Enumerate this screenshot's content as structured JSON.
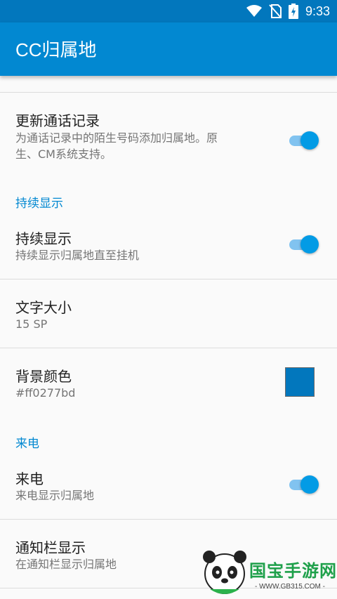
{
  "status_bar": {
    "time": "9:33",
    "icons": [
      "wifi-icon",
      "no-sim-icon",
      "battery-charging-icon"
    ]
  },
  "app_bar": {
    "title": "CC归属地"
  },
  "prefs": {
    "update_call_log": {
      "title": "更新通话记录",
      "summary_line1": "为通话记录中的陌生号码添加归属地。原",
      "summary_line2": "生、CM系统支持。",
      "enabled": true
    },
    "category_persistent": "持续显示",
    "persistent_display": {
      "title": "持续显示",
      "summary": "持续显示归属地直至挂机",
      "enabled": true
    },
    "text_size": {
      "title": "文字大小",
      "summary": "15 SP"
    },
    "background_color": {
      "title": "背景颜色",
      "summary": "#ff0277bd",
      "color": "#0277bd"
    },
    "category_incoming": "来电",
    "incoming_call": {
      "title": "来电",
      "summary": "来电显示归属地",
      "enabled": true
    },
    "notification_display": {
      "title": "通知栏显示",
      "summary": "在通知栏显示归属地"
    }
  },
  "watermark": {
    "text": "国宝手游网",
    "url": "- WWW.GB315.COM -"
  },
  "colors": {
    "status_bar": "#0277bd",
    "app_bar": "#0288d1",
    "accent": "#039be5"
  }
}
